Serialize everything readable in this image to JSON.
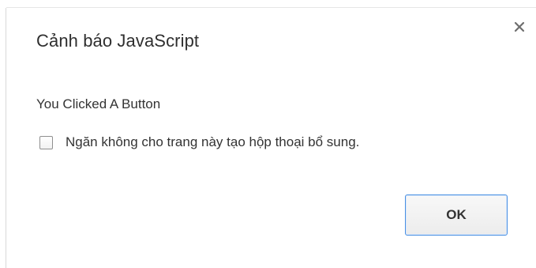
{
  "dialog": {
    "title": "Cảnh báo JavaScript",
    "message": "You Clicked A Button",
    "suppress_checkbox": {
      "label": "Ngăn không cho trang này tạo hộp thoại bổ sung.",
      "checked": false
    },
    "ok_label": "OK",
    "close_icon": "close-icon"
  },
  "colors": {
    "title_text": "#2f2f2f",
    "body_text": "#333333",
    "ok_focus_border": "#4a90e2"
  }
}
